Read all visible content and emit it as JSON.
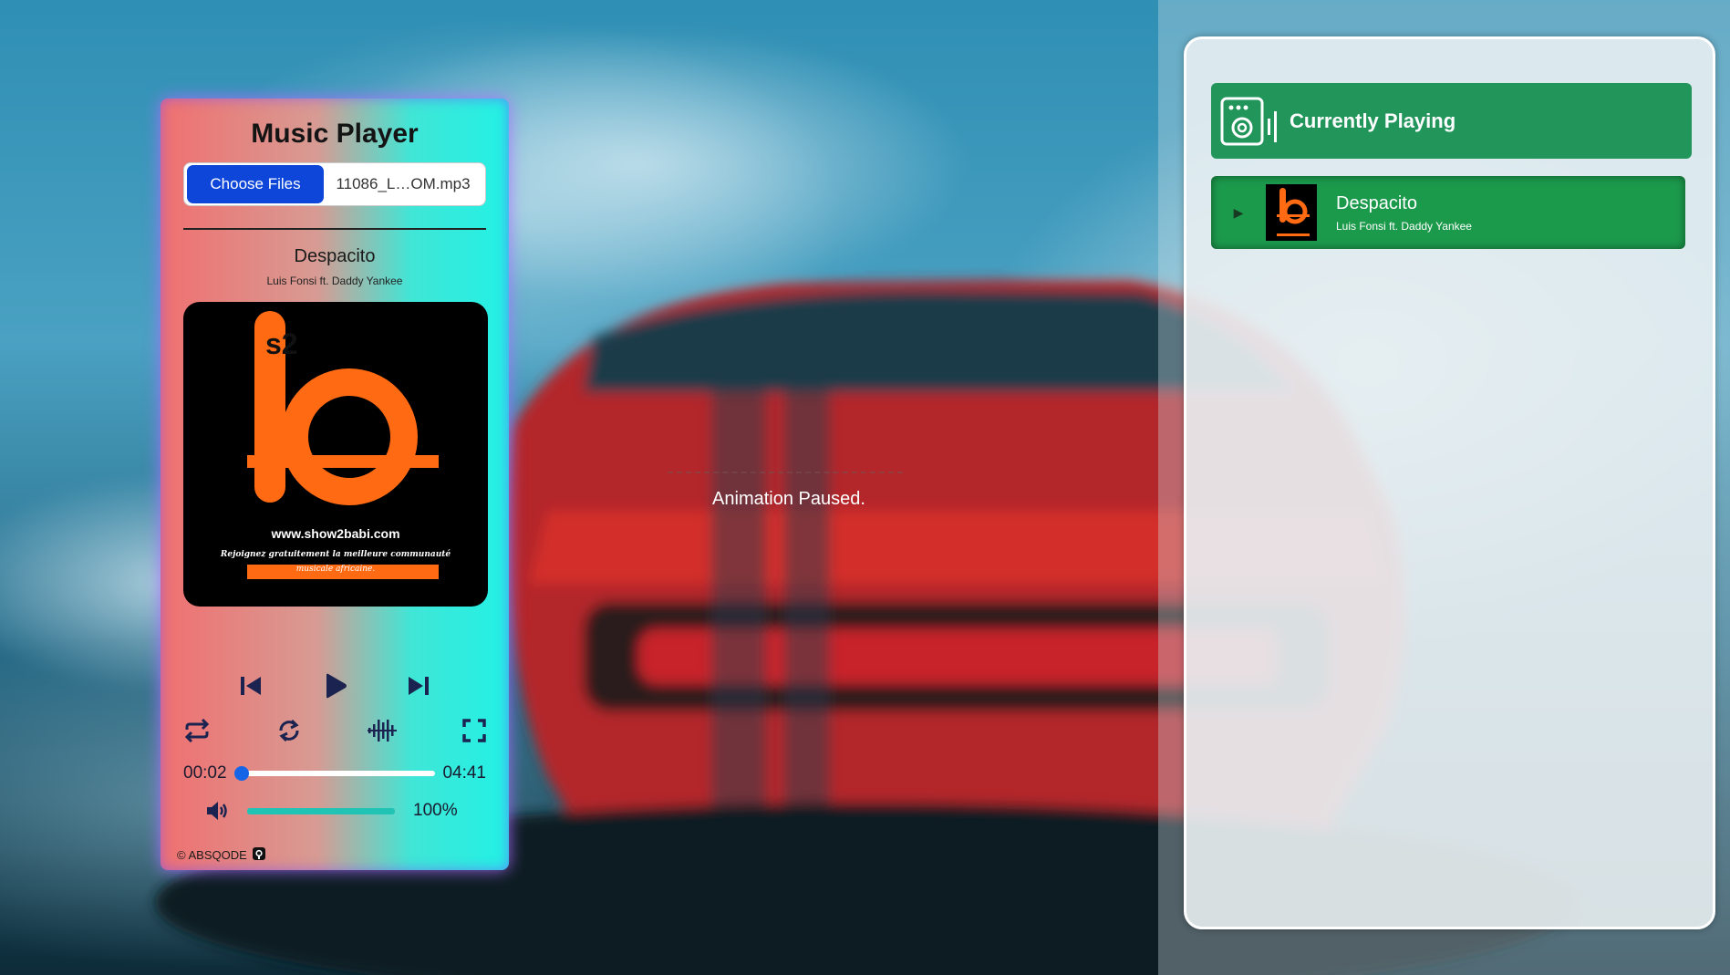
{
  "player": {
    "title": "Music Player",
    "choose_files_label": "Choose Files",
    "file_name": "11086_L…OM.mp3",
    "song_title": "Despacito",
    "song_artist": "Luis Fonsi ft. Daddy Yankee",
    "cover": {
      "brand_letters": "s2",
      "brand_url": "www.show2babi.com",
      "tagline_1": "Rejoignez gratuitement la meilleure communauté",
      "tagline_2": "musicale africaine."
    },
    "current_time": "00:02",
    "duration": "04:41",
    "progress_fraction": 0.007,
    "volume_label": "100%",
    "volume_fraction": 1.0,
    "footer_text": "© ABSQODE",
    "controls": {
      "prev_icon": "skip-back-icon",
      "play_icon": "play-icon",
      "next_icon": "skip-forward-icon",
      "repeat_icon": "repeat-icon",
      "loop_icon": "loop-icon",
      "visualizer_icon": "audio-wave-icon",
      "fullscreen_icon": "fullscreen-icon",
      "volume_icon": "volume-icon"
    }
  },
  "center": {
    "animation_status": "Animation Paused."
  },
  "queue": {
    "header_title": "Currently Playing",
    "header_icon": "speaker-icon",
    "accent_color": "#21955a",
    "items": [
      {
        "title": "Despacito",
        "artist": "Luis Fonsi ft. Daddy Yankee"
      }
    ]
  },
  "colors": {
    "choose_button": "#0d46d8",
    "progress_thumb": "#1565e6",
    "volume_fill": "#20c3b4"
  }
}
